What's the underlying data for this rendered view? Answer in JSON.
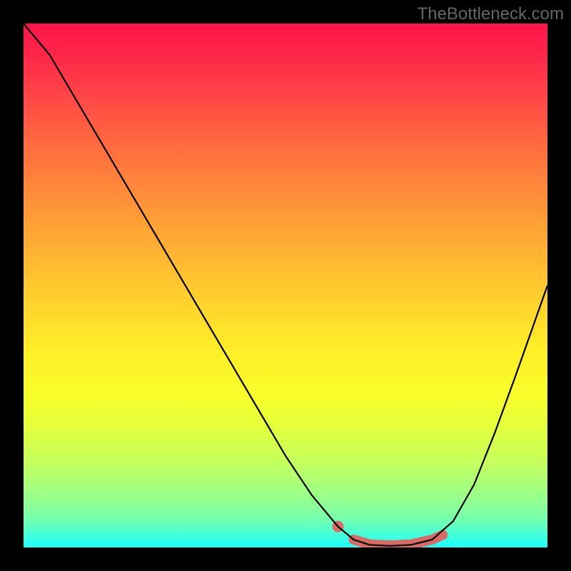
{
  "watermark": "TheBottleneck.com",
  "chart_data": {
    "type": "line",
    "title": "",
    "xlabel": "",
    "ylabel": "",
    "xlim": [
      0,
      100
    ],
    "ylim": [
      0,
      100
    ],
    "series": [
      {
        "name": "bottleneck-curve",
        "x": [
          0,
          5,
          10,
          15,
          20,
          25,
          30,
          35,
          40,
          45,
          50,
          55,
          60,
          63,
          66,
          70,
          74,
          78,
          82,
          86,
          90,
          94,
          100
        ],
        "y": [
          100,
          94,
          85.5,
          77,
          68.5,
          60,
          51.5,
          43,
          34.5,
          26,
          17.5,
          10,
          4,
          1.5,
          0.5,
          0.3,
          0.5,
          1.5,
          5,
          12,
          22,
          33,
          50
        ]
      }
    ],
    "highlight": {
      "dot": {
        "x": 60,
        "y": 4
      },
      "segment_x": [
        63,
        66,
        70,
        74,
        78,
        80
      ],
      "segment_y": [
        1.5,
        0.6,
        0.4,
        0.6,
        1.5,
        2.4
      ]
    }
  }
}
